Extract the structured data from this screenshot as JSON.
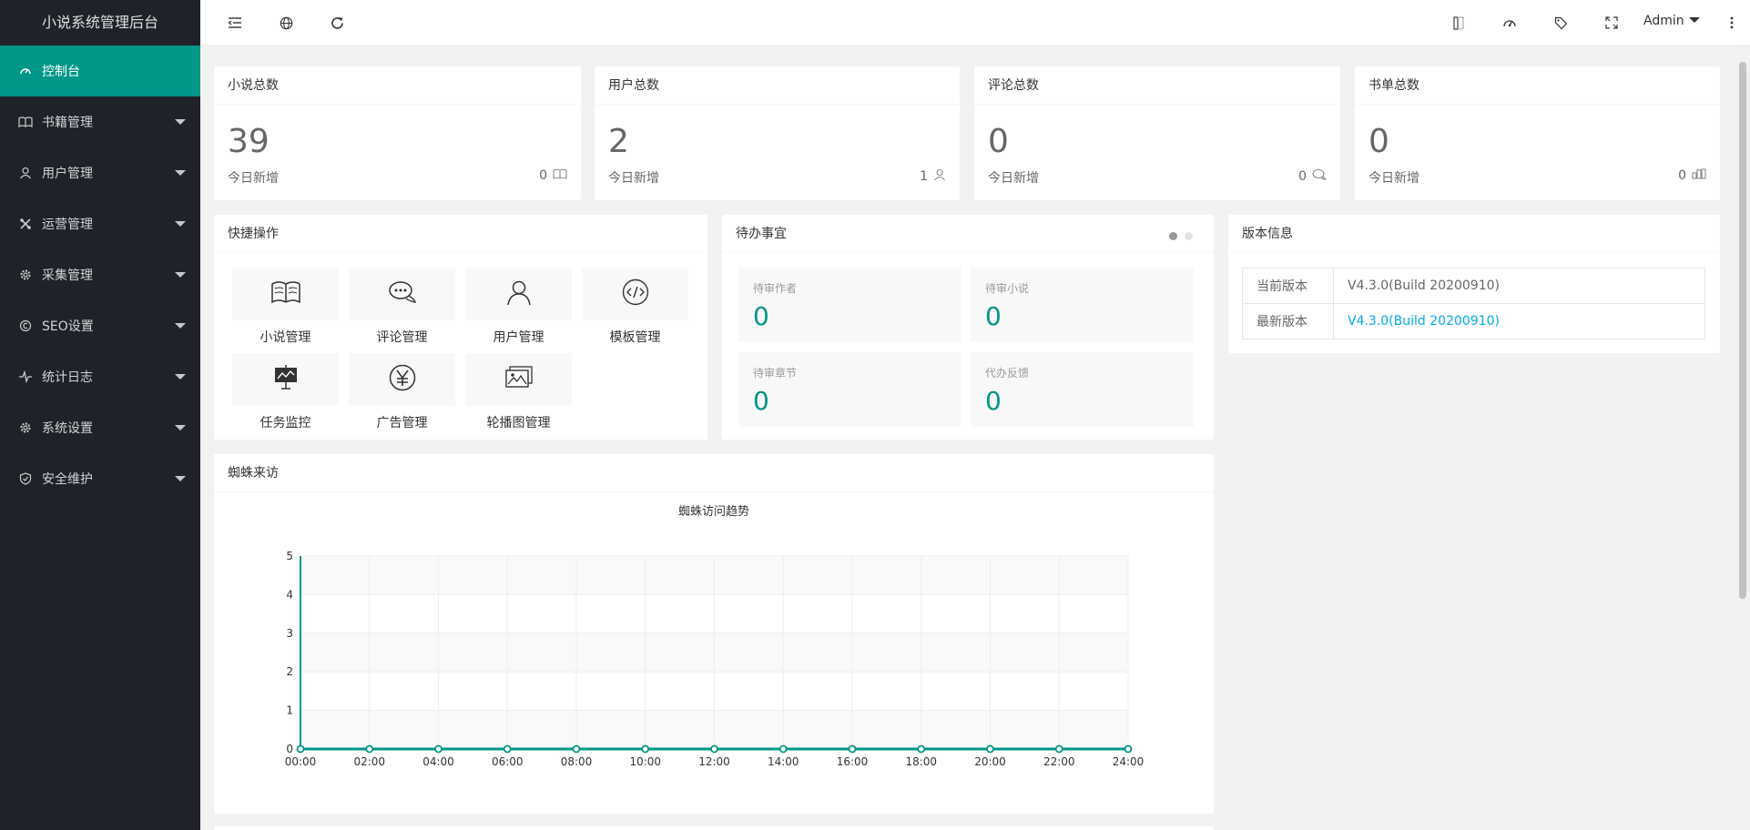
{
  "sidebar": {
    "logo": "小说系统管理后台",
    "items": [
      {
        "label": "控制台",
        "icon": "dashboard-icon",
        "active": true
      },
      {
        "label": "书籍管理",
        "icon": "book-icon"
      },
      {
        "label": "用户管理",
        "icon": "user-icon"
      },
      {
        "label": "运营管理",
        "icon": "tools-icon"
      },
      {
        "label": "采集管理",
        "icon": "gear-icon"
      },
      {
        "label": "SEO设置",
        "icon": "seo-icon"
      },
      {
        "label": "统计日志",
        "icon": "pulse-icon"
      },
      {
        "label": "系统设置",
        "icon": "gear-icon"
      },
      {
        "label": "安全维护",
        "icon": "shield-icon"
      }
    ]
  },
  "header": {
    "user": "Admin",
    "icons": [
      "menu-collapse-icon",
      "globe-icon",
      "refresh-icon",
      "theme-icon",
      "palette-icon",
      "tag-icon",
      "fullscreen-icon",
      "more-icon"
    ]
  },
  "stats": [
    {
      "title": "小说总数",
      "value": "39",
      "sub": "今日新增",
      "today": "0",
      "icon": "book-icon"
    },
    {
      "title": "用户总数",
      "value": "2",
      "sub": "今日新增",
      "today": "1",
      "icon": "user-icon"
    },
    {
      "title": "评论总数",
      "value": "0",
      "sub": "今日新增",
      "today": "0",
      "icon": "comment-icon"
    },
    {
      "title": "书单总数",
      "value": "0",
      "sub": "今日新增",
      "today": "0",
      "icon": "booklist-icon"
    }
  ],
  "quick": {
    "title": "快捷操作",
    "items": [
      {
        "label": "小说管理",
        "icon": "book-icon"
      },
      {
        "label": "评论管理",
        "icon": "comment-icon"
      },
      {
        "label": "用户管理",
        "icon": "user-icon"
      },
      {
        "label": "模板管理",
        "icon": "code-icon"
      },
      {
        "label": "任务监控",
        "icon": "monitor-icon"
      },
      {
        "label": "广告管理",
        "icon": "yen-icon"
      },
      {
        "label": "轮播图管理",
        "icon": "image-icon"
      }
    ]
  },
  "todo": {
    "title": "待办事宜",
    "items": [
      {
        "label": "待审作者",
        "value": "0"
      },
      {
        "label": "待审小说",
        "value": "0"
      },
      {
        "label": "待审章节",
        "value": "0"
      },
      {
        "label": "代办反馈",
        "value": "0"
      }
    ]
  },
  "version": {
    "title": "版本信息",
    "rows": [
      {
        "key": "当前版本",
        "value": "V4.3.0(Build 20200910)"
      },
      {
        "key": "最新版本",
        "value": "V4.3.0(Build 20200910)"
      }
    ]
  },
  "spider": {
    "title": "蜘蛛来访"
  },
  "chart_data": {
    "type": "line",
    "title": "蜘蛛访问趋势",
    "xlabel": "",
    "ylabel": "",
    "x": [
      "00:00",
      "02:00",
      "04:00",
      "06:00",
      "08:00",
      "10:00",
      "12:00",
      "14:00",
      "16:00",
      "18:00",
      "20:00",
      "22:00",
      "24:00"
    ],
    "series": [
      {
        "values": [
          0,
          0,
          0,
          0,
          0,
          0,
          0,
          0,
          0,
          0,
          0,
          0,
          0
        ]
      }
    ],
    "yticks": [
      "0",
      "1",
      "2",
      "3",
      "4",
      "5"
    ],
    "ylim": [
      0,
      5
    ],
    "grid": true,
    "color": "#009688"
  },
  "colors": {
    "accent": "#009688",
    "sidebar": "#20222a",
    "link": "#01aaed"
  }
}
